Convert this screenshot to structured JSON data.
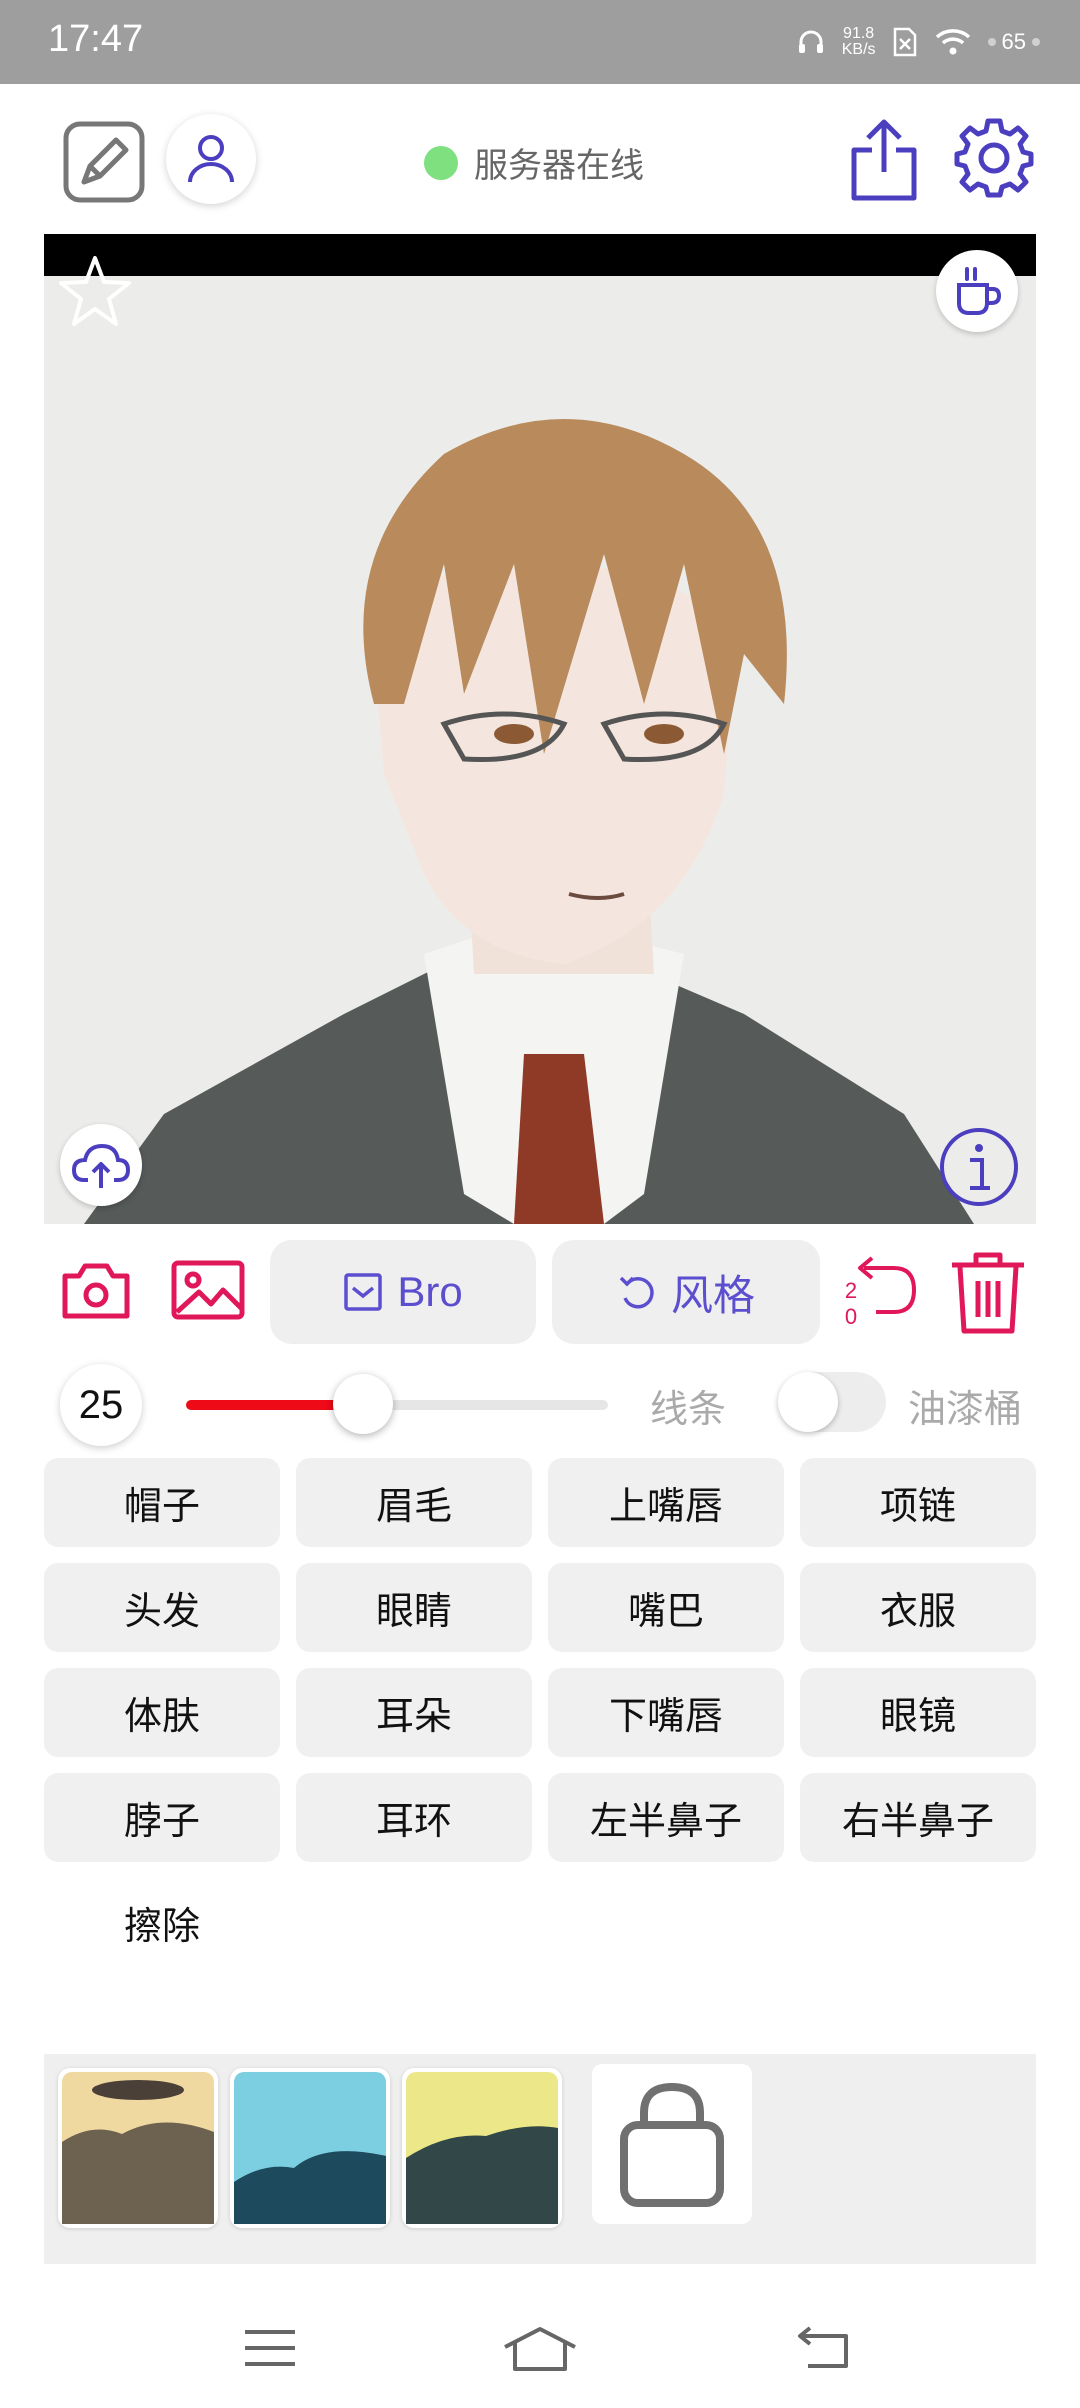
{
  "status_bar": {
    "time": "17:47",
    "net_speed": "91.8",
    "net_unit": "KB/s",
    "battery": "65"
  },
  "header": {
    "server_status": "服务器在线",
    "server_status_color": "#7ee07e",
    "accent": "#4b3fc0"
  },
  "toolbar": {
    "bro_label": "Bro",
    "style_label": "风格",
    "undo_count_top": "2",
    "undo_count_bottom": "0",
    "danger_color": "#e0185a"
  },
  "slider": {
    "brush_size": "25",
    "fill_fraction": 0.42,
    "line_label": "线条",
    "bucket_label": "油漆桶",
    "bucket_enabled": false
  },
  "parts": [
    "帽子",
    "眉毛",
    "上嘴唇",
    "项链",
    "头发",
    "眼睛",
    "嘴巴",
    "衣服",
    "体肤",
    "耳朵",
    "下嘴唇",
    "眼镜",
    "脖子",
    "耳环",
    "左半鼻子",
    "右半鼻子",
    "擦除"
  ],
  "palette": {
    "swatches": [
      "warm-beige-preset",
      "cyan-preset",
      "yellow-preset"
    ],
    "shop_icon": "shopping-bag-icon"
  }
}
